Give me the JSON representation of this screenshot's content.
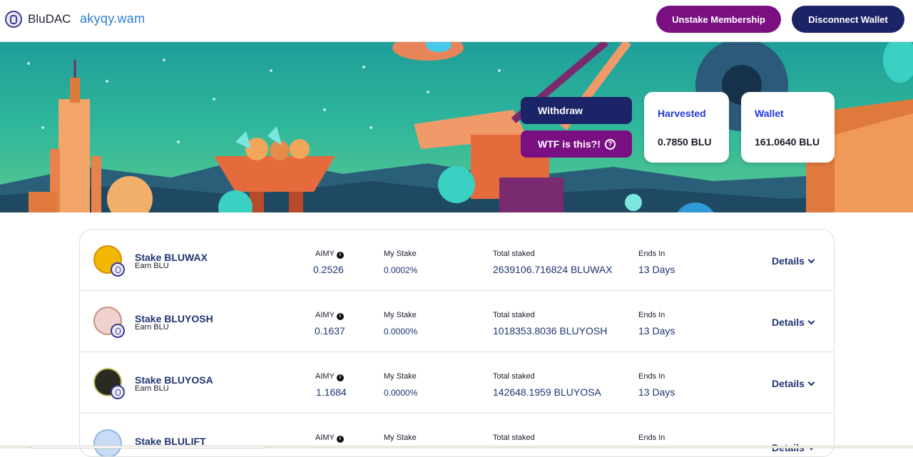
{
  "header": {
    "brand": "BluDAC",
    "account": "akyqy.wam",
    "unstake_label": "Unstake Membership",
    "disconnect_label": "Disconnect Wallet"
  },
  "banner": {
    "withdraw_label": "Withdraw",
    "wtf_label": "WTF is this?!",
    "help_glyph": "?",
    "harvested": {
      "label": "Harvested",
      "value": "0.7850 BLU"
    },
    "wallet": {
      "label": "Wallet",
      "value": "161.0640 BLU"
    }
  },
  "pools": [
    {
      "name": "Stake BLUWAX",
      "earn": "Earn BLU",
      "aimy_label": "AIMY",
      "aimy": "0.2526",
      "my_stake_label": "My Stake",
      "my_stake": "0.0002%",
      "total_label": "Total staked",
      "total": "2639106.716824 BLUWAX",
      "ends_label": "Ends In",
      "ends": "13 Days",
      "details": "Details",
      "icon_color": "#f2b705"
    },
    {
      "name": "Stake BLUYOSH",
      "earn": "Earn BLU",
      "aimy_label": "AIMY",
      "aimy": "0.1637",
      "my_stake_label": "My Stake",
      "my_stake": "0.0000%",
      "total_label": "Total staked",
      "total": "1018353.8036 BLUYOSH",
      "ends_label": "Ends In",
      "ends": "13 Days",
      "details": "Details",
      "icon_color": "#e8b7b0"
    },
    {
      "name": "Stake BLUYOSA",
      "earn": "Earn BLU",
      "aimy_label": "AIMY",
      "aimy": "1.1684",
      "my_stake_label": "My Stake",
      "my_stake": "0.0000%",
      "total_label": "Total staked",
      "total": "142648.1959 BLUYOSA",
      "ends_label": "Ends In",
      "ends": "13 Days",
      "details": "Details",
      "icon_color": "#2a2a22"
    },
    {
      "name": "Stake BLULIFT",
      "earn": "",
      "aimy_label": "AIMY",
      "aimy": "",
      "my_stake_label": "My Stake",
      "my_stake": "",
      "total_label": "Total staked",
      "total": "",
      "ends_label": "Ends In",
      "ends": "",
      "details": "Details",
      "icon_color": "#8fb8e8"
    }
  ]
}
